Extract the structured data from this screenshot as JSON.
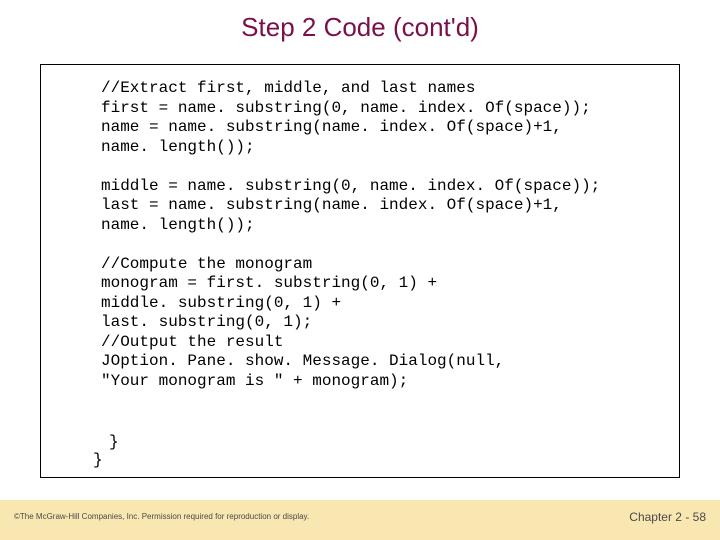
{
  "slide": {
    "title": "Step 2 Code (cont'd)"
  },
  "code": {
    "block": "//Extract first, middle, and last names\nfirst = name. substring(0, name. index. Of(space));\nname = name. substring(name. index. Of(space)+1,\nname. length());\n\nmiddle = name. substring(0, name. index. Of(space));\nlast = name. substring(name. index. Of(space)+1,\nname. length());\n\n//Compute the monogram\nmonogram = first. substring(0, 1) +\nmiddle. substring(0, 1) +\nlast. substring(0, 1);\n//Output the result\nJOption. Pane. show. Message. Dialog(null,\n\"Your monogram is \" + monogram);",
    "close_inner": "}",
    "close_outer": "}"
  },
  "footer": {
    "copyright": "©The McGraw-Hill Companies, Inc. Permission required for reproduction or display.",
    "page": "Chapter 2 - 58"
  }
}
